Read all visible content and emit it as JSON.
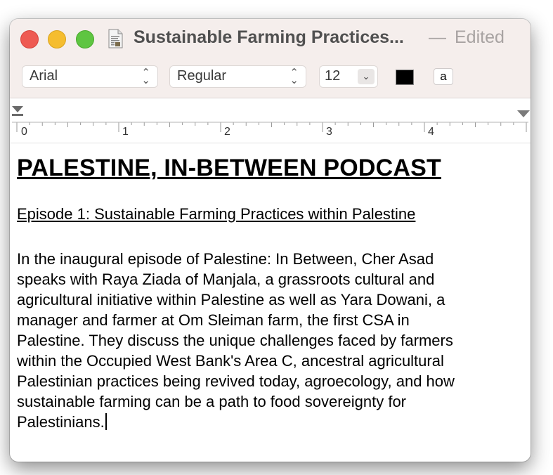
{
  "window": {
    "title": "Sustainable Farming Practices...",
    "separator": "—",
    "status": "Edited"
  },
  "toolbar": {
    "font_family": "Arial",
    "font_style": "Regular",
    "font_size": "12",
    "text_color": "#000000",
    "background_label": "a"
  },
  "ruler": {
    "labels": [
      "0",
      "1",
      "2",
      "3",
      "4"
    ]
  },
  "document": {
    "heading": "PALESTINE, IN-BETWEEN PODCAST",
    "subheading": "Episode 1: Sustainable Farming Practices within Palestine",
    "body": "In the inaugural episode of Palestine: In Between, Cher Asad\nspeaks with Raya Ziada of Manjala, a grassroots cultural and\nagricultural initiative within Palestine as well as Yara Dowani, a\nmanager and farmer at Om Sleiman farm, the first CSA in\nPalestine. They discuss the unique challenges faced by farmers\nwithin the Occupied West Bank's Area C, ancestral agricultural\nPalestinian practices being revived today, agroecology, and how\nsustainable farming can be a path to food sovereignty for\nPalestinians."
  }
}
